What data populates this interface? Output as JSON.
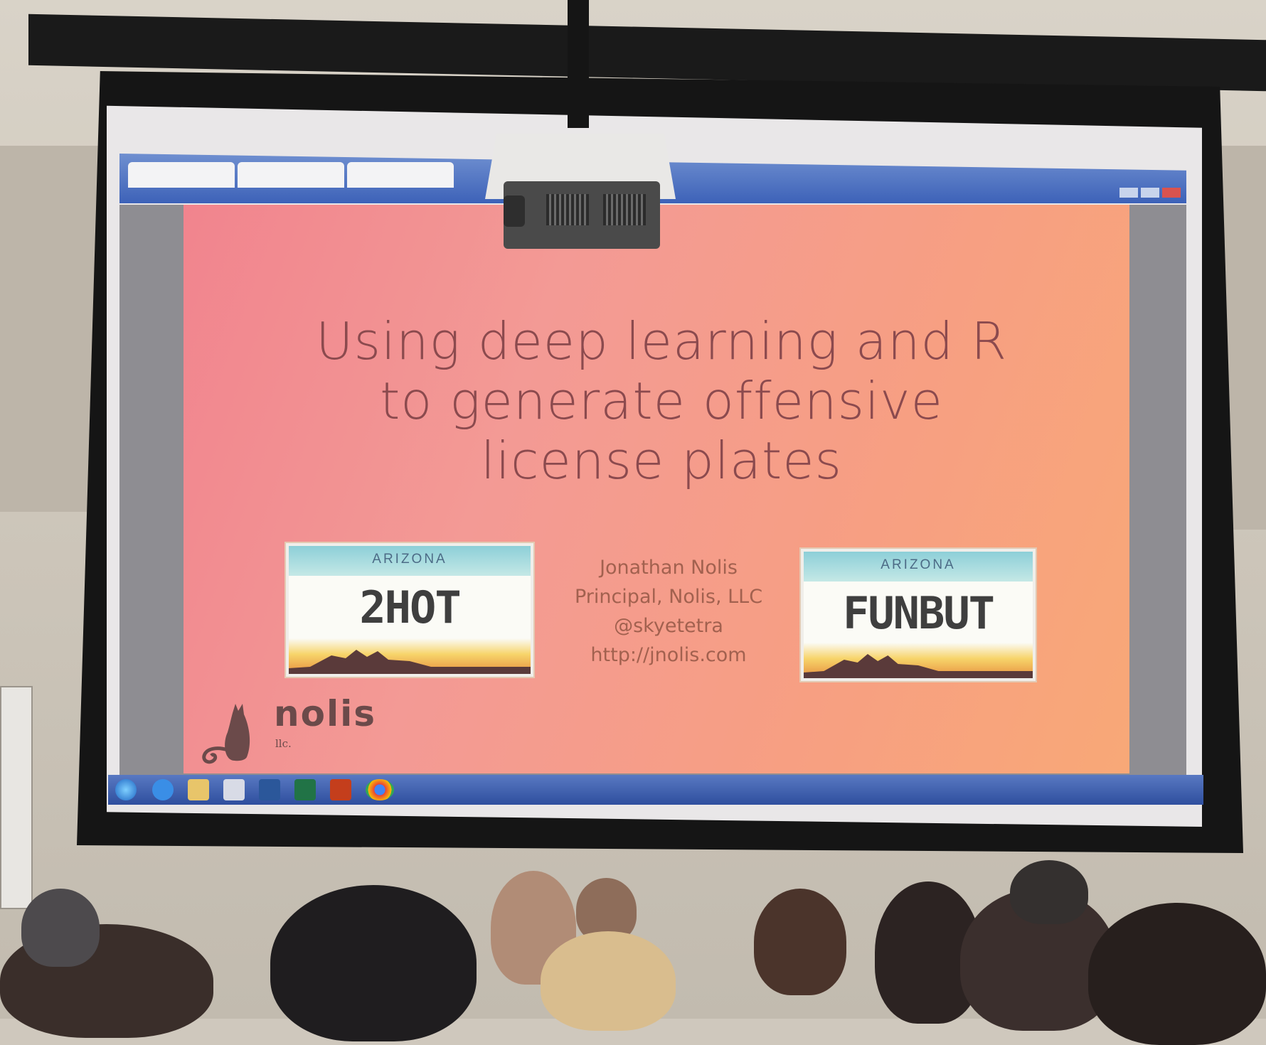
{
  "slide": {
    "title_lines": [
      "Using deep learning and R",
      "to generate offensive",
      "license plates"
    ],
    "author": {
      "name": "Jonathan Nolis",
      "role": "Principal, Nolis, LLC",
      "handle": "@skyetetra",
      "url": "http://jnolis.com"
    },
    "plates": [
      {
        "state": "ARIZONA",
        "text": "2HOT"
      },
      {
        "state": "ARIZONA",
        "text": "FUNBUT"
      }
    ],
    "logo": {
      "word": "nolis",
      "suffix": "llc."
    }
  },
  "taskbar": {
    "icons": [
      "start-orb-icon",
      "ie-icon",
      "explorer-icon",
      "notepad-icon",
      "word-icon",
      "excel-icon",
      "powerpoint-icon",
      "chrome-icon"
    ]
  },
  "colors": {
    "slide_gradient_start": "#f1848e",
    "slide_gradient_end": "#f8a877",
    "title_text": "#8b4a4e",
    "author_text": "#a2614f",
    "taskbar": "#3d62b8"
  }
}
